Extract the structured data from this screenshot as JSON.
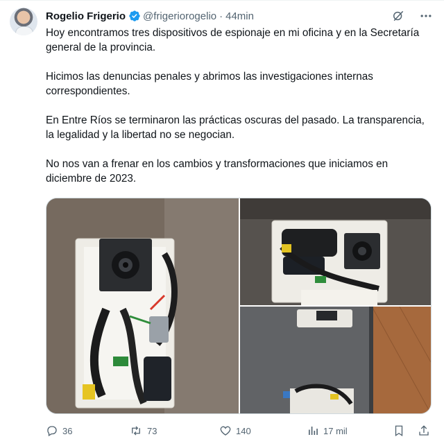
{
  "author": {
    "name": "Rogelio Frigerio",
    "handle": "@frigeriorogelio",
    "separator": "·",
    "time": "44min"
  },
  "icons": {
    "verified": "verified-badge-icon",
    "grok": "grok-icon",
    "more": "more-icon",
    "reply": "reply-icon",
    "retweet": "retweet-icon",
    "like": "heart-icon",
    "views": "views-icon",
    "bookmark": "bookmark-icon",
    "share": "share-icon"
  },
  "colors": {
    "verified": "#1d9bf0",
    "text": "#0f1419",
    "muted": "#536471"
  },
  "tweet": {
    "paragraphs": [
      "Hoy encontramos tres dispositivos de espionaje en mi oficina y en la Secretaría general de la provincia.",
      "Hicimos las denuncias penales y abrimos las investigaciones internas correspondientes.",
      "En Entre Ríos se terminaron las prácticas oscuras del pasado. La transparencia, la legalidad y la libertad no se negocian.",
      "No nos van a frenar en los cambios y transformaciones que iniciamos en diciembre de 2023."
    ]
  },
  "stats": {
    "replies": "36",
    "retweets": "73",
    "likes": "140",
    "views": "17 mil"
  }
}
